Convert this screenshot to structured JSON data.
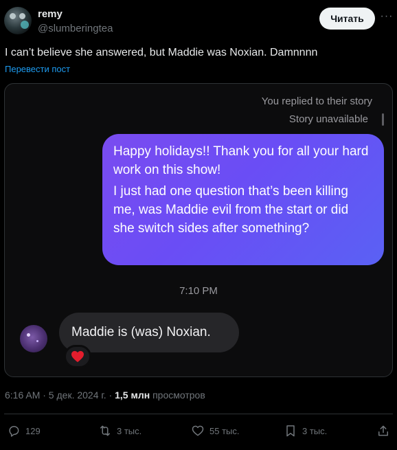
{
  "author": {
    "name": "remy",
    "handle": "@slumberingtea",
    "follow_label": "Читать",
    "more_label": "···"
  },
  "tweet": {
    "text": "I can’t believe she answered, but Maddie was Noxian. Damnnnn",
    "translate_label": "Перевести пост"
  },
  "screenshot": {
    "replied_label": "You replied to their story",
    "story_label": "Story unavailable",
    "message_1": "Happy holidays!! Thank you for all your hard work on this show!",
    "message_2": "I just had one question that’s been killing me, was Maddie evil from the start or did she switch sides after something?",
    "time": "7:10 PM",
    "reply": "Maddie is (was) Noxian.",
    "reaction_icon": "red-heart-icon",
    "bubble_color": "#6a4df5",
    "reply_bubble_color": "#262629"
  },
  "meta": {
    "timestamp": "6:16 AM · 5 дек. 2024 г.",
    "separator": " · ",
    "views_count": "1,5 млн",
    "views_label": "просмотров"
  },
  "actions": {
    "replies": "129",
    "reposts": "3 тыс.",
    "likes": "55 тыс.",
    "bookmarks": "3 тыс."
  },
  "colors": {
    "accent": "#1d9bf0",
    "muted": "#71767b",
    "background": "#000000"
  }
}
